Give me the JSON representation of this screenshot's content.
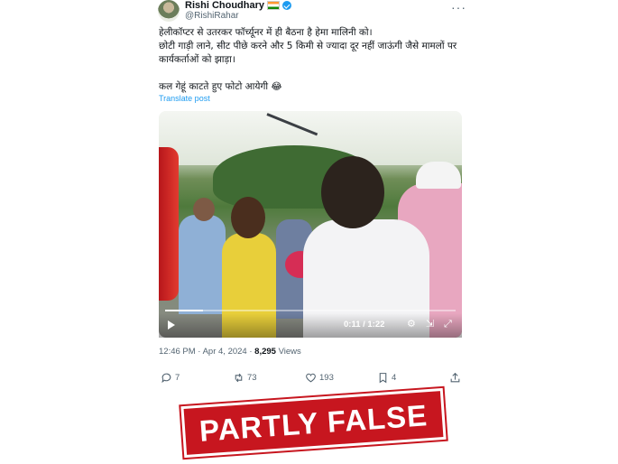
{
  "author": {
    "name": "Rishi Choudhary",
    "handle": "@RishiRahar"
  },
  "tweet": {
    "lines": [
      "हेलीकॉप्टर से उतरकर फॉर्च्यूनर में ही बैठना है हेमा मालिनी को।",
      "छोटी गाड़ी लाने, सीट पीछे करने और 5 किमी से ज्यादा दूर नहीं जाऊंगी जैसे मामलों पर",
      "कार्यकर्ताओं को झाड़ा।",
      "",
      "कल गेहूं काटते हुए फोटो आयेगी 😂"
    ],
    "translate": "Translate post"
  },
  "video": {
    "time": "0:11 / 1:22",
    "progress": 0.13
  },
  "meta": {
    "time": "12:46 PM · Apr 4, 2024 · ",
    "views": "8,295",
    "views_label": " Views"
  },
  "actions": {
    "replies": "7",
    "reposts": "73",
    "likes": "193",
    "bookmarks": "4"
  },
  "stamp": "PARTLY FALSE"
}
